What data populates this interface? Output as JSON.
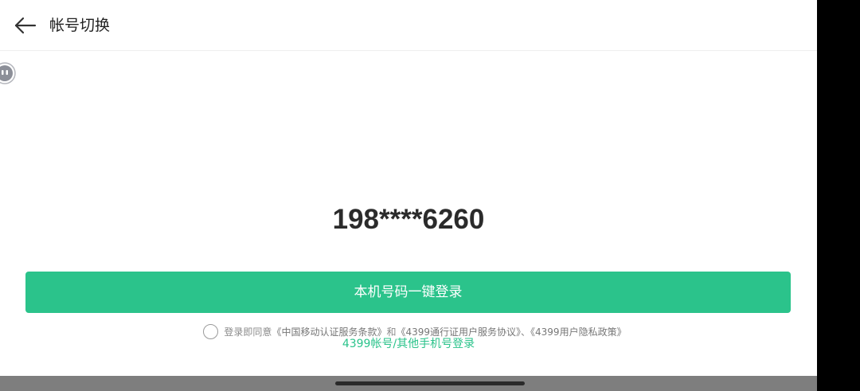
{
  "header": {
    "back_icon": "arrow-left-icon",
    "title": "帐号切换"
  },
  "floating_ball": {
    "icon": "chat-bubble-icon"
  },
  "account": {
    "phone_masked": "198****6260"
  },
  "login_button": {
    "label": "本机号码一键登录"
  },
  "agreement": {
    "checked": false,
    "prefix": "登录即同意",
    "link1": "《中国移动认证服务条款》",
    "and": "和",
    "link2": "《4399通行证用户服务协议》",
    "sep": "、",
    "link3": "《4399用户隐私政策》"
  },
  "other_login": {
    "label": "4399帐号/其他手机号登录"
  },
  "colors": {
    "accent": "#2bc38b",
    "text_dark": "#2b2b2b",
    "text_muted": "#8a8a8a",
    "nav_bar": "#7e7e7e"
  }
}
